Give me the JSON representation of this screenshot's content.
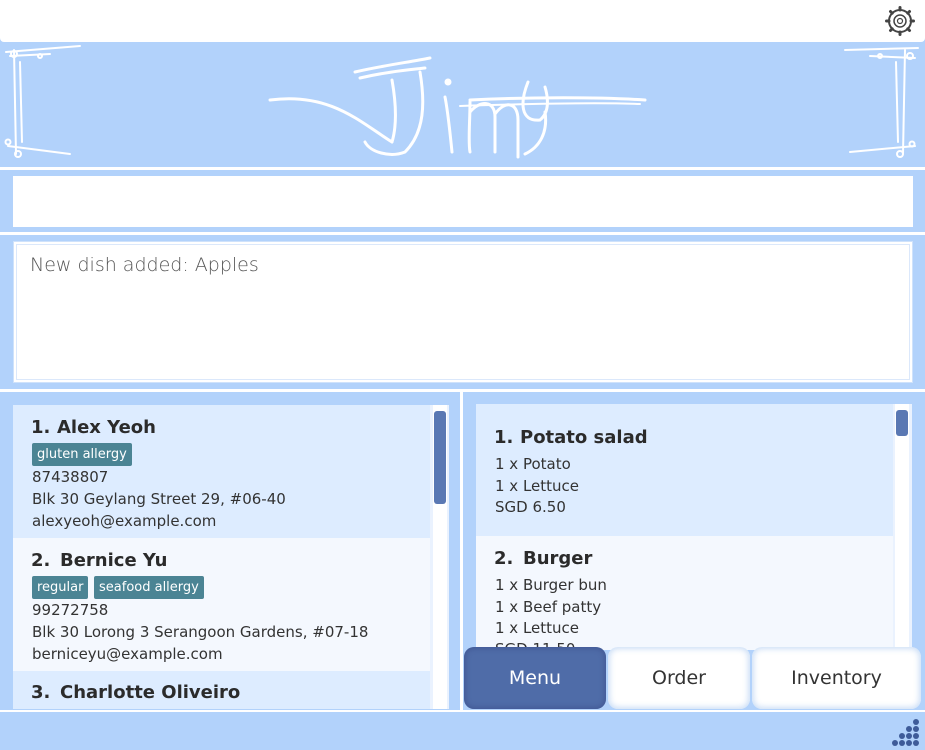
{
  "window": {
    "settings_icon": "gear-icon",
    "logo_text": "Jimy"
  },
  "command": {
    "value": "",
    "placeholder": ""
  },
  "result": {
    "message": "New dish added: Apples"
  },
  "persons": [
    {
      "index": "1.",
      "name": "Alex Yeoh",
      "tags": [
        "gluten allergy"
      ],
      "phone": "87438807",
      "address": "Blk 30 Geylang Street 29, #06-40",
      "email": "alexyeoh@example.com"
    },
    {
      "index": "2.",
      "name": "Bernice Yu",
      "tags": [
        "regular",
        "seafood allergy"
      ],
      "phone": "99272758",
      "address": "Blk 30 Lorong 3 Serangoon Gardens, #07-18",
      "email": "berniceyu@example.com"
    },
    {
      "index": "3.",
      "name": "Charlotte Oliveiro",
      "tags": [],
      "phone": "",
      "address": "",
      "email": ""
    }
  ],
  "menu": [
    {
      "index": "1.",
      "name": "Potato salad",
      "ingredients": [
        "1 x Potato",
        "1 x Lettuce"
      ],
      "price": "SGD 6.50"
    },
    {
      "index": "2.",
      "name": "Burger",
      "ingredients": [
        "1 x Burger bun",
        "1 x Beef patty",
        "1 x Lettuce"
      ],
      "price": "SGD 11.50"
    }
  ],
  "tabs": [
    {
      "label": "Menu",
      "active": true
    },
    {
      "label": "Order",
      "active": false
    },
    {
      "label": "Inventory",
      "active": false
    }
  ],
  "colors": {
    "background": "#b2d2fb",
    "accent": "#4f6ca8",
    "tag": "#4b8494"
  }
}
